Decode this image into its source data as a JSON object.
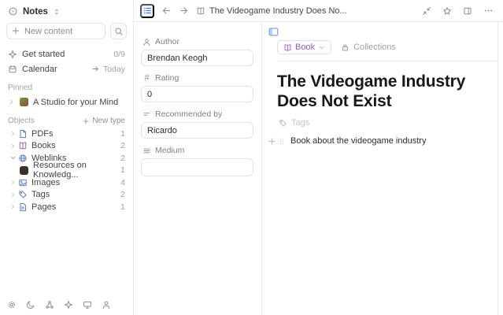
{
  "sidebar": {
    "space": {
      "name": "Notes"
    },
    "search": {
      "placeholder": "New content"
    },
    "get_started": {
      "label": "Get started",
      "count": "0/9"
    },
    "calendar": {
      "label": "Calendar",
      "action": "Today"
    },
    "pinned": {
      "header": "Pinned",
      "items": [
        {
          "label": "A Studio for your Mind"
        }
      ]
    },
    "objects": {
      "header": "Objects",
      "new_type_label": "New type",
      "items": [
        {
          "label": "PDFs",
          "count": "1",
          "icon": "pdf-file"
        },
        {
          "label": "Books",
          "count": "2",
          "icon": "book"
        },
        {
          "label": "Weblinks",
          "count": "2",
          "icon": "globe"
        },
        {
          "label": "Resources on Knowledg...",
          "count": "1",
          "icon": "favicon"
        },
        {
          "label": "Images",
          "count": "4",
          "icon": "image"
        },
        {
          "label": "Tags",
          "count": "2",
          "icon": "tag"
        },
        {
          "label": "Pages",
          "count": "1",
          "icon": "page"
        }
      ]
    }
  },
  "header": {
    "doc_title": "The Videogame Industry Does No..."
  },
  "properties": {
    "author": {
      "label": "Author",
      "value": "Brendan Keogh"
    },
    "rating": {
      "label": "Rating",
      "value": "0",
      "icon_glyph": "#"
    },
    "recommended_by": {
      "label": "Recommended by",
      "value": "Ricardo"
    },
    "medium": {
      "label": "Medium",
      "value": ""
    }
  },
  "editor": {
    "type_chip_label": "Book",
    "collections_label": "Collections",
    "title": "The Videogame Industry Does Not Exist",
    "tags_label": "Tags",
    "body_text": "Book about the videogame industry"
  },
  "colors": {
    "accent_blue": "#4c7ae0",
    "accent_purple": "#9a57d3"
  }
}
